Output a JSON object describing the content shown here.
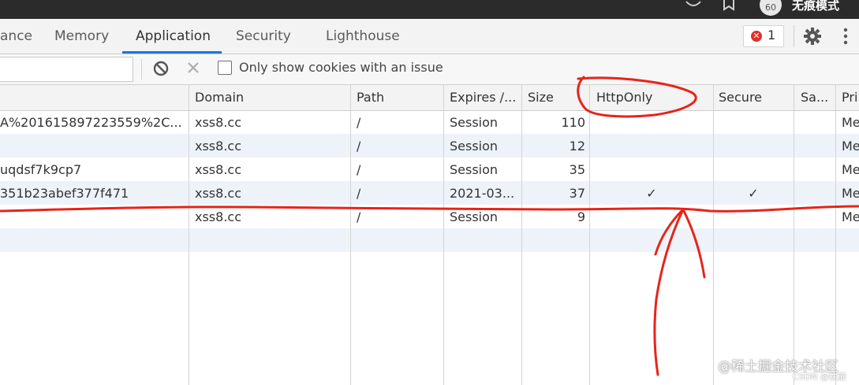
{
  "titlebar": {
    "profile_initials": "60",
    "profile_name": "无痕模式"
  },
  "tabs": [
    {
      "label": "ance"
    },
    {
      "label": "Memory"
    },
    {
      "label": "Application"
    },
    {
      "label": "Security"
    },
    {
      "label": "Lighthouse"
    }
  ],
  "active_tab": "Application",
  "errors": {
    "count": "1",
    "icon_glyph": "✕"
  },
  "toolbar": {
    "filter_value": "",
    "only_issue_label": "Only show cookies with an issue",
    "only_issue_checked": false
  },
  "table": {
    "columns": [
      "Domain",
      "Path",
      "Expires /...",
      "Size",
      "HttpOnly",
      "Secure",
      "Sa...",
      "Pri..."
    ],
    "rows": [
      {
        "name": "A%201615897223559%2C...",
        "domain": "xss8.cc",
        "path": "/",
        "expires": "Session",
        "size": "110",
        "httponly": "",
        "secure": "",
        "samesite": "",
        "priority": "Me"
      },
      {
        "name": "",
        "domain": "xss8.cc",
        "path": "/",
        "expires": "Session",
        "size": "12",
        "httponly": "",
        "secure": "",
        "samesite": "",
        "priority": "Me"
      },
      {
        "name": "uqdsf7k9cp7",
        "domain": "xss8.cc",
        "path": "/",
        "expires": "Session",
        "size": "35",
        "httponly": "",
        "secure": "",
        "samesite": "",
        "priority": "Me"
      },
      {
        "name": "351b23abef377f471",
        "domain": "xss8.cc",
        "path": "/",
        "expires": "2021-03...",
        "size": "37",
        "httponly": "✓",
        "secure": "✓",
        "samesite": "",
        "priority": "Me"
      },
      {
        "name": "",
        "domain": "xss8.cc",
        "path": "/",
        "expires": "Session",
        "size": "9",
        "httponly": "",
        "secure": "",
        "samesite": "",
        "priority": "Me"
      }
    ]
  },
  "watermark": {
    "text": "@稀土掘金技术社区",
    "sub": "CSDN @枕嵌"
  },
  "colors": {
    "accent": "#1a73e8",
    "error": "#e0312d",
    "annotation": "#e8231a",
    "row_alt": "#eef3fa"
  }
}
